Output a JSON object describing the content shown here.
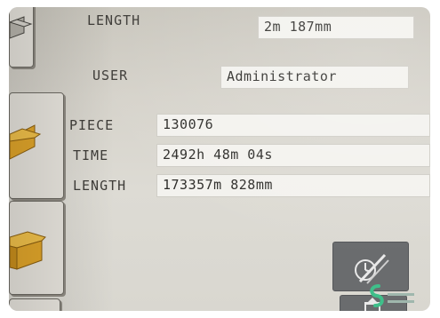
{
  "fields": {
    "length_label": "LENGTH",
    "length_value": "2m 187mm",
    "user_label": "USER",
    "user_value": "Administrator",
    "piece_label": "PIECE",
    "piece_value": "130076",
    "time_label": "TIME",
    "time_value": "2492h 48m 04s",
    "total_length_label": "LENGTH",
    "total_length_value": "173357m 828mm"
  },
  "icons": {
    "side_top": "box-icon",
    "side_mid": "wood-board-icon",
    "side_low": "wood-board-icon",
    "action_top": "reset-counter-icon",
    "action_bottom": "export-icon"
  },
  "colors": {
    "screen_bg": "#d6d3cb",
    "field_bg": "#f3f2ee",
    "board": "#e0a52a",
    "action_bg": "#6a6c6e"
  }
}
